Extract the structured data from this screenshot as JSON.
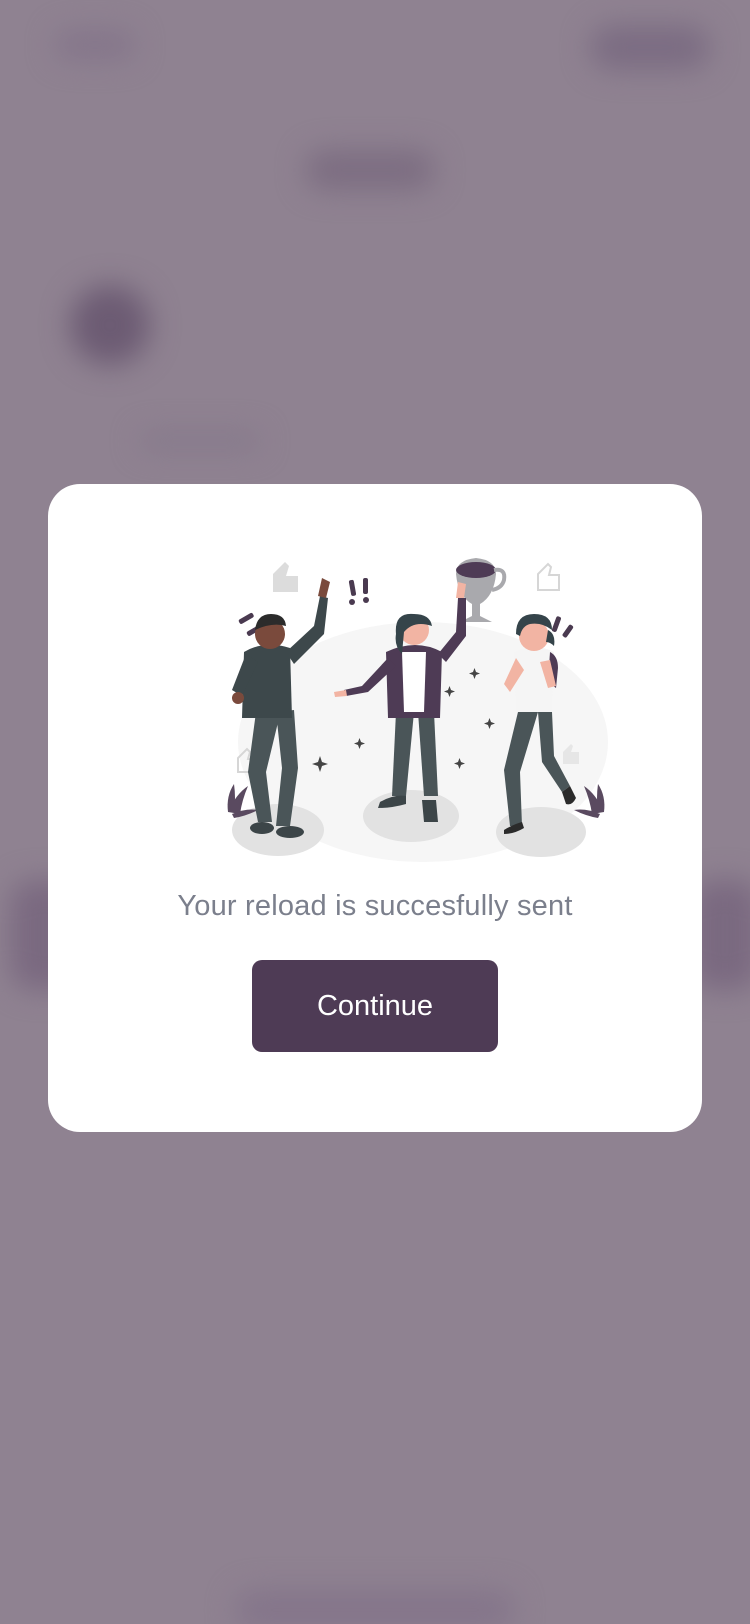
{
  "modal": {
    "message": "Your reload is succesfully sent",
    "continue_label": "Continue",
    "illustration_icon": "celebration-people-trophy-icon"
  },
  "colors": {
    "overlay": "#8f8291",
    "primary": "#4e3b55",
    "message_text": "#7b7f8c",
    "card": "#ffffff"
  }
}
